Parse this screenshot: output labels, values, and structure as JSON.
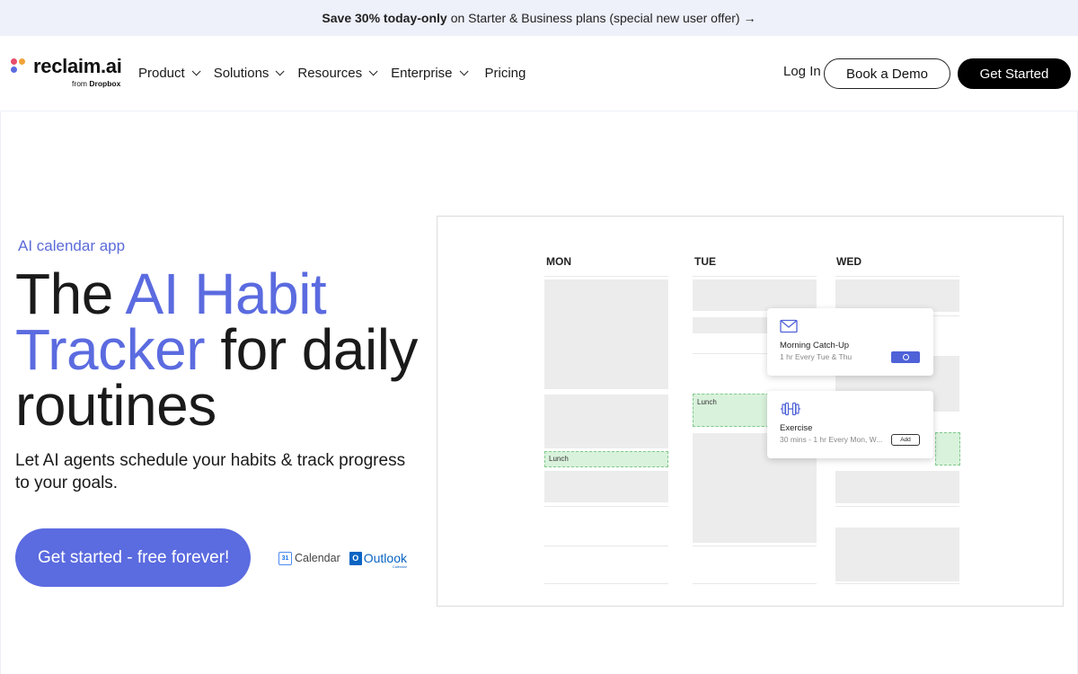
{
  "promo": {
    "bold": "Save 30% today-only",
    "rest": "on Starter & Business plans (special new user offer)",
    "arrow": "→"
  },
  "header": {
    "logo_text": "reclaim.ai",
    "logo_sub_prefix": "from",
    "logo_sub_brand": "Dropbox",
    "logo_colors": [
      "#e84c6b",
      "#f2a33a",
      "#5b6be0"
    ],
    "nav": [
      {
        "label": "Product",
        "dropdown": true
      },
      {
        "label": "Solutions",
        "dropdown": true
      },
      {
        "label": "Resources",
        "dropdown": true
      },
      {
        "label": "Enterprise",
        "dropdown": true
      },
      {
        "label": "Pricing",
        "dropdown": false
      }
    ],
    "login": "Log In",
    "book_demo": "Book a Demo",
    "get_started": "Get Started"
  },
  "hero": {
    "eyebrow": "AI calendar app",
    "headline_part1": "The ",
    "headline_accent": "AI Habit Tracker",
    "headline_part2": " for daily routines",
    "subhead": "Let AI agents schedule your habits & track progress to your goals.",
    "cta": "Get started - free forever!",
    "accent_color": "#5b6be0",
    "integrations": {
      "gcal_icon": "31",
      "gcal_label": "Calendar",
      "outlook_icon": "O",
      "outlook_label": "Outlook",
      "outlook_sub": "Calendar"
    }
  },
  "calendar": {
    "days": [
      "MON",
      "TUE",
      "WED"
    ],
    "lunch_label": "Lunch",
    "cards": [
      {
        "icon": "envelope-icon",
        "title": "Morning Catch-Up",
        "meta": "1 hr Every Tue & Thu",
        "action": "check"
      },
      {
        "icon": "dumbbell-icon",
        "title": "Exercise",
        "meta": "30 mins - 1 hr Every Mon, W...",
        "action": "Add"
      }
    ]
  }
}
